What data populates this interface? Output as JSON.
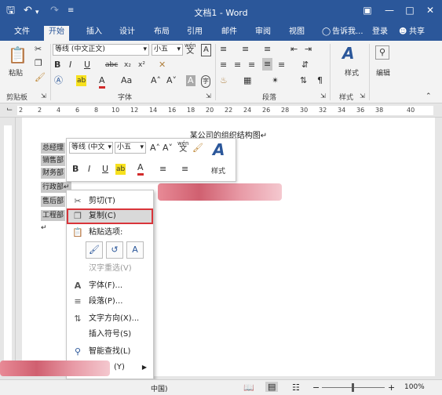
{
  "titlebar": {
    "title": "文档1 - Word",
    "save_icon": "save-icon",
    "undo_icon": "undo-icon",
    "redo_icon": "redo-icon",
    "customize_icon": "customize-icon",
    "ribbon_display_icon": "ribbon-display-icon",
    "minimize_icon": "minimize-icon",
    "maximize_icon": "maximize-icon",
    "close_icon": "close-icon"
  },
  "tabs": [
    "文件",
    "开始",
    "插入",
    "设计",
    "布局",
    "引用",
    "邮件",
    "审阅",
    "视图"
  ],
  "tell_me": "告诉我...",
  "login": "登录",
  "share": "共享",
  "ribbon": {
    "paste": "粘贴",
    "clipboard": "剪贴板",
    "font_name": "等线 (中文正文)",
    "font_size": "小五",
    "font": "字体",
    "paragraph": "段落",
    "styles_btn": "样式",
    "styles_group": "样式",
    "editing": "编辑",
    "wen_a": "wén",
    "wen_b": "文",
    "a_box": "A",
    "bold": "B",
    "italic": "I",
    "underline": "U",
    "strike": "abc",
    "sub": "x₂",
    "sup": "x²",
    "grow": "A˄",
    "shrink": "A˅",
    "aa": "Aa",
    "font_color": "A",
    "highlight": "ab",
    "char_border": "A",
    "enclose": "字"
  },
  "ruler_numbers": [
    "2",
    "2",
    "4",
    "6",
    "8",
    "10",
    "12",
    "14",
    "16",
    "18",
    "20",
    "22",
    "24",
    "26",
    "28",
    "30",
    "32",
    "34",
    "36",
    "38",
    "40"
  ],
  "document": {
    "title": "某公司的组织结构图↵",
    "lines": [
      "总经理",
      "销售部",
      "财务部",
      "行政部↵",
      "售后部",
      "工程部"
    ],
    "trailing_mark": "↵"
  },
  "mini_toolbar": {
    "font_name": "等线 (中文",
    "font_size": "小五",
    "grow": "A˄",
    "shrink": "A˅",
    "wen_a": "wén",
    "wen_b": "文",
    "bold": "B",
    "italic": "I",
    "underline": "U",
    "highlight": "ab",
    "font_color": "A",
    "styles": "样式"
  },
  "context_menu": {
    "cut": "剪切(T)",
    "copy": "复制(C)",
    "paste_options": "粘贴选项:",
    "reconvert": "汉字重选(V)",
    "font": "字体(F)...",
    "paragraph": "段落(P)...",
    "text_direction": "文字方向(X)...",
    "insert_symbol": "插入符号(S)",
    "smart_lookup": "智能查找(L)",
    "more": "(Y)"
  },
  "status": {
    "language": "中国)",
    "zoom": "100%",
    "minus": "−",
    "plus": "+"
  },
  "colors": {
    "brand": "#2b579a",
    "highlight_border": "#d9343a",
    "font_red": "#d22b2b",
    "highlight_yellow": "#f7e11d"
  }
}
